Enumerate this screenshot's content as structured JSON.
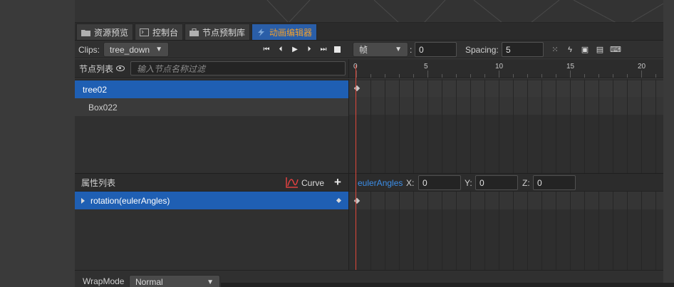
{
  "tabs": [
    {
      "label": "资源预览",
      "icon": "folder-icon"
    },
    {
      "label": "控制台",
      "icon": "console-icon"
    },
    {
      "label": "节点预制库",
      "icon": "briefcase-icon"
    },
    {
      "label": "动画编辑器",
      "icon": "lightning-icon",
      "active": true
    }
  ],
  "toolbar": {
    "clips_label": "Clips:",
    "clip_value": "tree_down",
    "unit_value": "帧",
    "colon": ":",
    "frame_value": "0",
    "spacing_label": "Spacing:",
    "spacing_value": "5"
  },
  "node_list": {
    "title": "节点列表",
    "filter_placeholder": "输入节点名称过滤",
    "items": [
      {
        "label": "tree02",
        "selected": true
      },
      {
        "label": "Box022",
        "selected": false
      }
    ]
  },
  "ruler": {
    "labels": [
      "0",
      "5",
      "10",
      "15",
      "20"
    ]
  },
  "properties": {
    "title": "属性列表",
    "curve_label": "Curve",
    "add_label": "+",
    "items": [
      {
        "label": "rotation(eulerAngles)"
      }
    ]
  },
  "euler": {
    "name": "eulerAngles",
    "x_label": "X:",
    "x_value": "0",
    "y_label": "Y:",
    "y_value": "0",
    "z_label": "Z:",
    "z_value": "0"
  },
  "footer": {
    "wrap_label": "WrapMode",
    "wrap_value": "Normal"
  },
  "colors": {
    "selected": "#1f5fb3",
    "active_tab_text": "#f0a030",
    "playhead": "#e0473a",
    "link": "#3c8ee8"
  }
}
